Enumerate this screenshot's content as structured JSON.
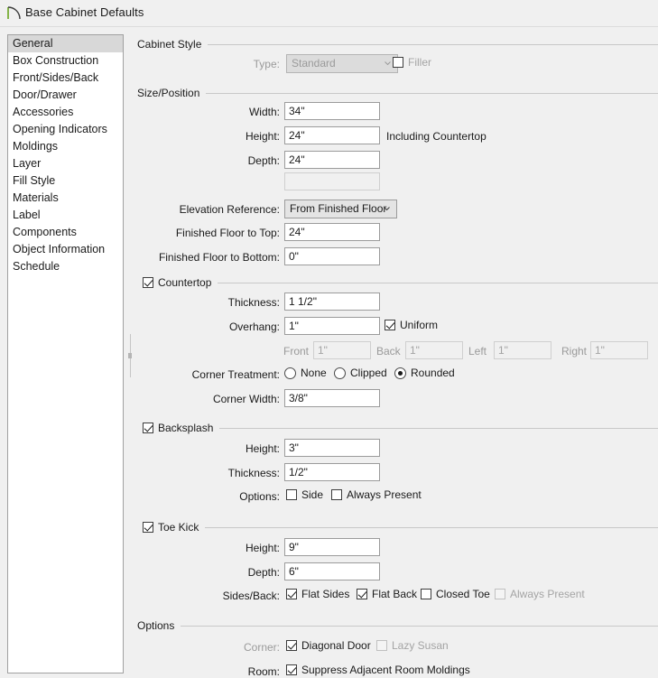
{
  "window": {
    "title": "Base Cabinet Defaults",
    "icon": "cabinet-arc-icon"
  },
  "sidebar": {
    "selected": "General",
    "items": [
      "General",
      "Box Construction",
      "Front/Sides/Back",
      "Door/Drawer",
      "Accessories",
      "Opening Indicators",
      "Moldings",
      "Layer",
      "Fill Style",
      "Materials",
      "Label",
      "Components",
      "Object Information",
      "Schedule"
    ]
  },
  "sections": {
    "cabinet_style": {
      "title": "Cabinet Style",
      "type_label": "Type:",
      "type_value": "Standard",
      "filler_label": "Filler",
      "filler_checked": false
    },
    "size_position": {
      "title": "Size/Position",
      "width_label": "Width:",
      "width_value": "34\"",
      "height_label": "Height:",
      "height_value": "24\"",
      "height_note": "Including Countertop",
      "depth_label": "Depth:",
      "depth_value": "24\"",
      "extra_value": "",
      "elevation_label": "Elevation Reference:",
      "elevation_value": "From Finished Floor",
      "floor_to_top_label": "Finished Floor to Top:",
      "floor_to_top_value": "24\"",
      "floor_to_bottom_label": "Finished Floor to Bottom:",
      "floor_to_bottom_value": "0\""
    },
    "countertop": {
      "title": "Countertop",
      "checked": true,
      "thickness_label": "Thickness:",
      "thickness_value": "1 1/2\"",
      "overhang_label": "Overhang:",
      "overhang_value": "1\"",
      "uniform_label": "Uniform",
      "uniform_checked": true,
      "front_label": "Front",
      "front_value": "1\"",
      "back_label": "Back",
      "back_value": "1\"",
      "left_label": "Left",
      "left_value": "1\"",
      "right_label": "Right",
      "right_value": "1\"",
      "corner_treatment_label": "Corner Treatment:",
      "corner_none": "None",
      "corner_clipped": "Clipped",
      "corner_rounded": "Rounded",
      "corner_selected": "Rounded",
      "corner_width_label": "Corner Width:",
      "corner_width_value": "3/8\""
    },
    "backsplash": {
      "title": "Backsplash",
      "checked": true,
      "height_label": "Height:",
      "height_value": "3\"",
      "thickness_label": "Thickness:",
      "thickness_value": "1/2\"",
      "options_label": "Options:",
      "side_label": "Side",
      "side_checked": false,
      "always_present_label": "Always Present",
      "always_present_checked": false
    },
    "toe_kick": {
      "title": "Toe Kick",
      "checked": true,
      "height_label": "Height:",
      "height_value": "9\"",
      "depth_label": "Depth:",
      "depth_value": "6\"",
      "sides_back_label": "Sides/Back:",
      "flat_sides_label": "Flat Sides",
      "flat_sides_checked": true,
      "flat_back_label": "Flat Back",
      "flat_back_checked": true,
      "closed_toe_label": "Closed Toe",
      "closed_toe_checked": false,
      "always_present_label": "Always Present",
      "always_present_checked": false
    },
    "options": {
      "title": "Options",
      "corner_label": "Corner:",
      "diagonal_door_label": "Diagonal Door",
      "diagonal_door_checked": true,
      "lazy_susan_label": "Lazy Susan",
      "lazy_susan_checked": false,
      "room_label": "Room:",
      "suppress_label": "Suppress Adjacent Room Moldings",
      "suppress_checked": true
    }
  },
  "colors": {
    "background": "#f0f0f0",
    "field_border": "#9b9b9b",
    "disabled_text": "#9a9a9a",
    "rule": "#c8c8c8",
    "selection": "#d8d8d8",
    "icon_accent": "#6aa61e"
  }
}
